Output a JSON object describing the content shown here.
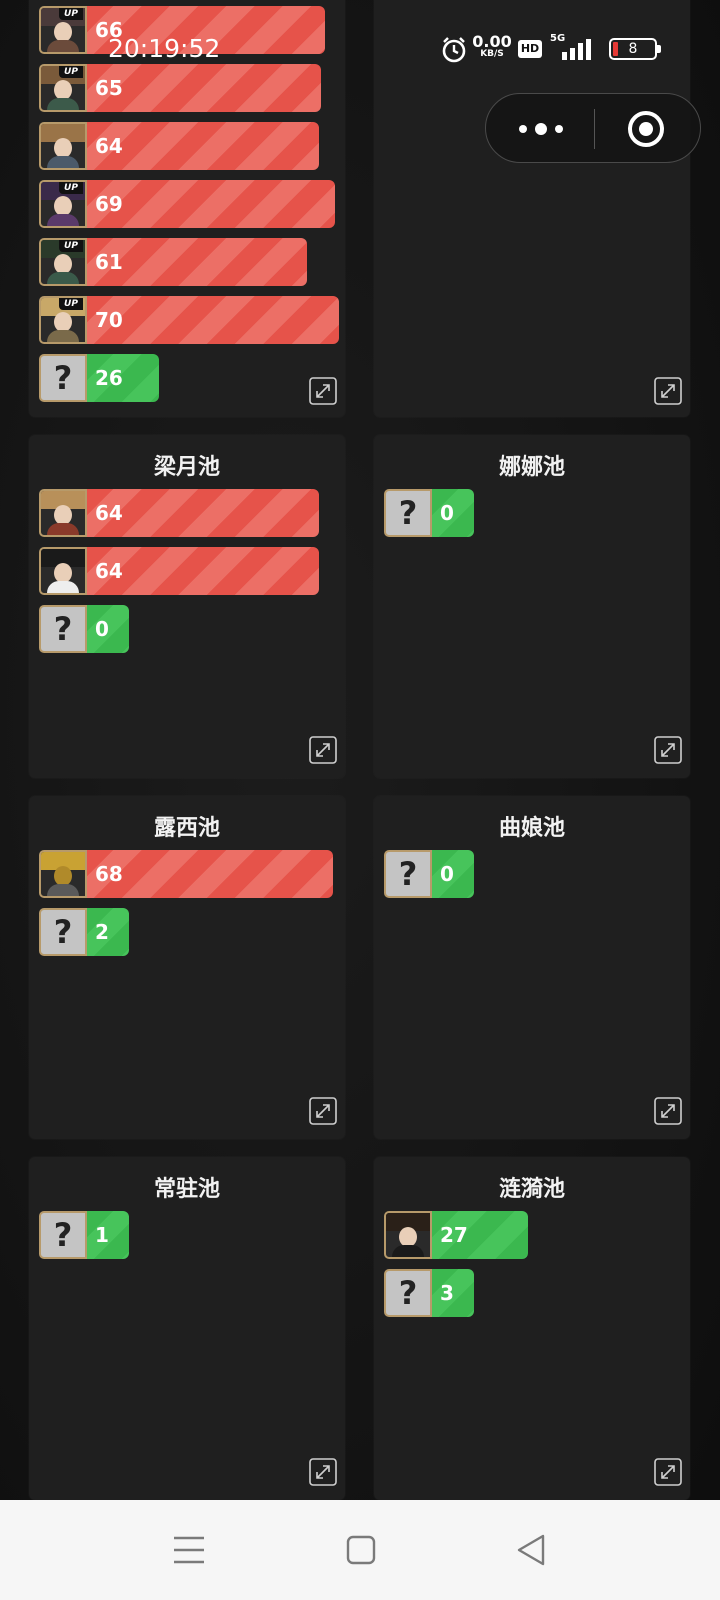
{
  "status_bar": {
    "time": "20:19:52",
    "net_speed": "0.00",
    "net_unit": "KB/S",
    "hd": "HD",
    "network": "5G",
    "battery": "8"
  },
  "capsule": {
    "more_icon": "more-dots-icon",
    "close_icon": "target-close-icon"
  },
  "top_left_card": {
    "rows": [
      {
        "value": "66",
        "type": "char",
        "up": "UP"
      },
      {
        "value": "65",
        "type": "char",
        "up": "UP"
      },
      {
        "value": "64",
        "type": "char"
      },
      {
        "value": "69",
        "type": "char",
        "up": "UP"
      },
      {
        "value": "61",
        "type": "char",
        "up": "UP"
      },
      {
        "value": "70",
        "type": "char",
        "up": "UP"
      },
      {
        "value": "26",
        "type": "unknown"
      }
    ]
  },
  "pools": [
    {
      "title": "梁月池",
      "rows": [
        {
          "value": "64"
        },
        {
          "value": "64"
        },
        {
          "value": "0",
          "unknown": "?"
        }
      ]
    },
    {
      "title": "娜娜池",
      "rows": [
        {
          "value": "0",
          "unknown": "?"
        }
      ]
    },
    {
      "title": "露西池",
      "rows": [
        {
          "value": "68"
        },
        {
          "value": "2",
          "unknown": "?"
        }
      ]
    },
    {
      "title": "曲娘池",
      "rows": [
        {
          "value": "0",
          "unknown": "?"
        }
      ]
    },
    {
      "title": "常驻池",
      "rows": [
        {
          "value": "1",
          "unknown": "?"
        }
      ]
    },
    {
      "title": "涟漪池",
      "rows": [
        {
          "value": "27"
        },
        {
          "value": "3",
          "unknown": "?"
        }
      ]
    }
  ],
  "unknown_symbol": "?",
  "colors": {
    "bar_red": "#e6534a",
    "bar_green": "#3bb84f",
    "card_bg": "#1f1f1f",
    "avatar_border": "#b79a6a"
  },
  "nav": {
    "menu_icon": "menu-icon",
    "home_icon": "home-square-icon",
    "back_icon": "back-triangle-icon"
  }
}
